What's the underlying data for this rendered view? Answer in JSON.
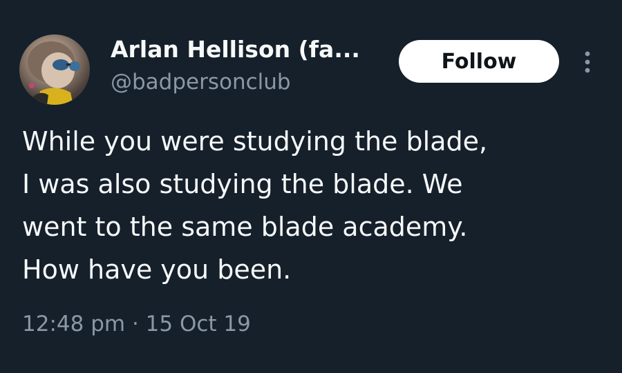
{
  "tweet": {
    "author": {
      "display_name": "Arlan Hellison (fa...",
      "handle": "@badpersonclub",
      "avatar_icon": "profile-photo"
    },
    "follow_label": "Follow",
    "more_icon": "more-vertical-icon",
    "body_lines": [
      "While you were studying the blade,",
      "I was also studying the blade. We",
      "went to the same blade academy.",
      "How have you been."
    ],
    "time": "12:48 pm",
    "separator": "·",
    "date": "15 Oct 19"
  },
  "colors": {
    "background": "#15202b",
    "primary_text": "#f7f9f9",
    "secondary_text": "#8b98a5",
    "follow_bg": "#ffffff",
    "follow_text": "#0f1419"
  }
}
